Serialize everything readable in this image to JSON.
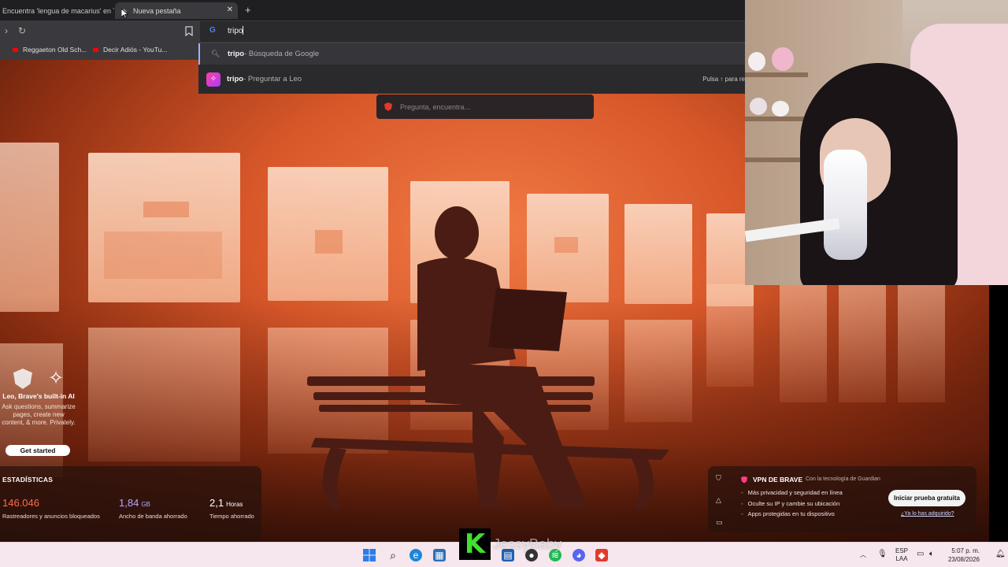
{
  "tabs": [
    {
      "label": "Encuentra 'lengua de macarius' en Ti",
      "active": false
    },
    {
      "label": "Nueva pestaña",
      "active": true
    }
  ],
  "omnibox": {
    "value": "tripo"
  },
  "bookmarks": [
    {
      "label": "Reggaeton Old Sch..."
    },
    {
      "label": "Decir Adiós - YouTu..."
    }
  ],
  "suggestions": [
    {
      "query": "tripo",
      "suffix": " - Búsqueda de Google",
      "icon": "search-icon"
    },
    {
      "query": "tripo",
      "suffix": " - Preguntar a Leo",
      "icon": "leo-icon",
      "hint": "Pulsa ↑ para re"
    }
  ],
  "leo_bar": {
    "placeholder": "Pregunta, encuentra..."
  },
  "leo_promo": {
    "title": "Leo, Brave's built-in AI",
    "description": "Ask questions, summarize pages, create new content, & more. Privately.",
    "button": "Get started"
  },
  "stats": {
    "title": "ESTADÍSTICAS",
    "items": [
      {
        "value": "146.046",
        "unit": "",
        "label": "Rastreadores y anuncios bloqueados",
        "color": "#ff6a4d"
      },
      {
        "value": "1,84",
        "unit": "GB",
        "label": "Ancho de banda ahorrado",
        "color": "#b9a6ff"
      },
      {
        "value": "2,1",
        "unit": "Horas",
        "label": "Tiempo ahorrado",
        "color": "#ffffff"
      }
    ]
  },
  "vpn": {
    "title": "VPN DE BRAVE",
    "powered": "Con la tecnología de Guardian",
    "features": [
      "Más privacidad y seguridad en línea",
      "Oculte su IP y cambie su ubicación",
      "Apps protegidas en tu dispositivo"
    ],
    "cta": "Iniciar prueba gratuita",
    "link": "¿Ya lo has adquirido?"
  },
  "watermark": {
    "letter": "K",
    "name": "JessyBaby"
  },
  "tray": {
    "lang_top": "ESP",
    "lang_bottom": "LAA",
    "time": "5:07 p. m.",
    "date": "23/08/2026"
  }
}
